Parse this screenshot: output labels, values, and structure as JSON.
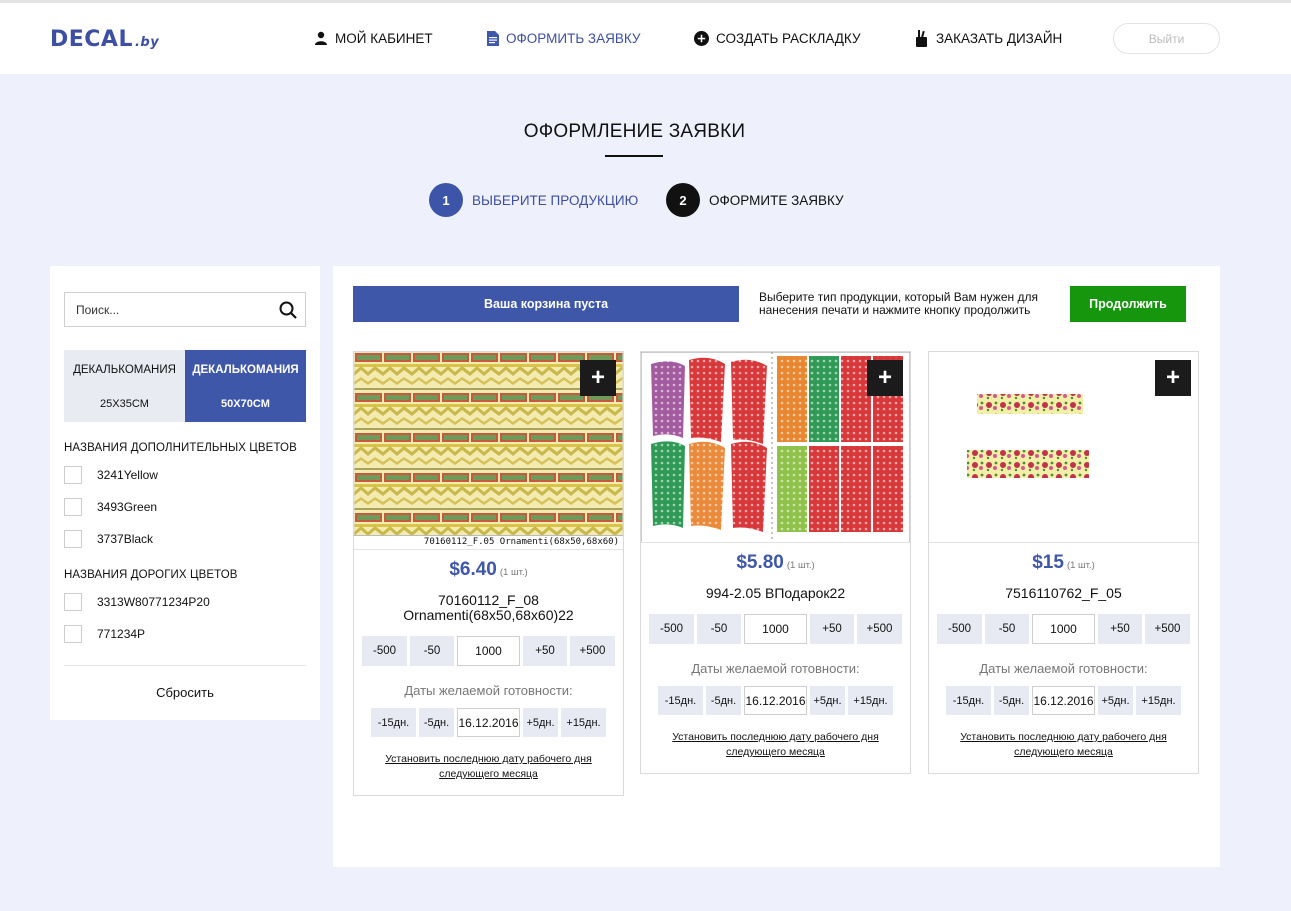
{
  "header": {
    "logo_main": "DECAL",
    "logo_suffix": ".by",
    "nav": [
      {
        "label": "МОЙ КАБИНЕТ",
        "icon": "user-icon"
      },
      {
        "label": "ОФОРМИТЬ ЗАЯВКУ",
        "icon": "document-icon",
        "active": true
      },
      {
        "label": "СОЗДАТЬ РАСКЛАДКУ",
        "icon": "plus-circle-icon"
      },
      {
        "label": "ЗАКАЗАТЬ ДИЗАЙН",
        "icon": "brush-cup-icon"
      }
    ],
    "logout_label": "Выйти"
  },
  "page": {
    "title": "ОФОРМЛЕНИЕ ЗАЯВКИ",
    "steps": [
      {
        "num": "1",
        "label": "ВЫБЕРИТЕ ПРОДУКЦИЮ",
        "active": true
      },
      {
        "num": "2",
        "label": "ОФОРМИТЕ ЗАЯВКУ"
      }
    ]
  },
  "sidebar": {
    "search_placeholder": "Поиск...",
    "format_tabs": [
      {
        "name": "ДЕКАЛЬКОМАНИЯ",
        "size": "25X35CM",
        "active": false
      },
      {
        "name": "ДЕКАЛЬКОМАНИЯ",
        "size": "50X70CM",
        "active": true
      }
    ],
    "group1_title": "НАЗВАНИЯ ДОПОЛНИТЕЛЬНЫХ ЦВЕТОВ",
    "group1_items": [
      "3241Yellow",
      "3493Green",
      "3737Black"
    ],
    "group2_title": "НАЗВАНИЯ ДОРОГИХ ЦВЕТОВ",
    "group2_items": [
      "3313W80771234P20",
      "771234P"
    ],
    "reset_label": "Сбросить"
  },
  "toolbar": {
    "cart_label": "Ваша корзина пуста",
    "hint": "Выберите тип продукции, который Вам нужен для нанесения печати и нажмите кнопку продолжить",
    "continue_label": "Продолжить"
  },
  "colors": {
    "brand": "#3f57a9",
    "continue": "#16960d",
    "page_bg": "#eef0fb"
  },
  "products": [
    {
      "price": "$6.40",
      "qty_note": "(1 шт.)",
      "name": "70160112_F_08 Ornamenti(68x50,68x60)22",
      "image_caption": "70160112_F.05 Ornamenti(68x50,68x60)",
      "qty_buttons": [
        "-500",
        "-50",
        "+50",
        "+500"
      ],
      "qty_value": "1000",
      "dates_label": "Даты желаемой готовности:",
      "date_buttons": [
        "-15дн.",
        "-5дн.",
        "+5дн.",
        "+15дн."
      ],
      "date_value": "16.12.2016",
      "last_date_link": "Установить последнюю дату рабочего дня следующего месяца"
    },
    {
      "price": "$5.80",
      "qty_note": "(1 шт.)",
      "name": "994-2.05 ВПодарок22",
      "qty_buttons": [
        "-500",
        "-50",
        "+50",
        "+500"
      ],
      "qty_value": "1000",
      "dates_label": "Даты желаемой готовности:",
      "date_buttons": [
        "-15дн.",
        "-5дн.",
        "+5дн.",
        "+15дн."
      ],
      "date_value": "16.12.2016",
      "last_date_link": "Установить последнюю дату рабочего дня следующего месяца"
    },
    {
      "price": "$15",
      "qty_note": "(1 шт.)",
      "name": "7516110762_F_05",
      "qty_buttons": [
        "-500",
        "-50",
        "+50",
        "+500"
      ],
      "qty_value": "1000",
      "dates_label": "Даты желаемой готовности:",
      "date_buttons": [
        "-15дн.",
        "-5дн.",
        "+5дн.",
        "+15дн."
      ],
      "date_value": "16.12.2016",
      "last_date_link": "Установить последнюю дату рабочего дня следующего месяца"
    }
  ]
}
